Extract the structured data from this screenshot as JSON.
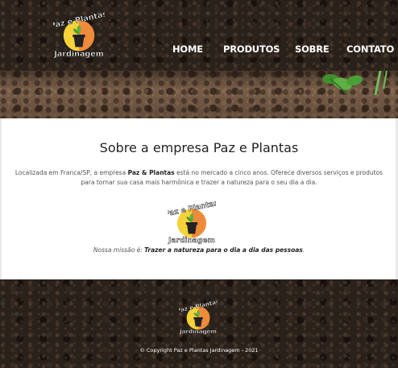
{
  "brand": {
    "logo_line1": "Paz e Plantas",
    "logo_line2": "Jardinagem"
  },
  "nav": {
    "home": "HOME",
    "produtos": "PRODUTOS",
    "sobre": "SOBRE",
    "contato": "CONTATO"
  },
  "main": {
    "title": "Sobre a empresa Paz e Plantas",
    "intro_before": "Localizada em Franca/SP, a empresa ",
    "intro_bold": "Paz & Plantas",
    "intro_after": " está no mercado a cinco anos. Oferece diversos serviços e produtos para tornar sua casa mais harmônica e trazer a natureza para o seu dia a dia.",
    "mission_label": "Nossa missão é: ",
    "mission_text": "Trazer a natureza para o dia a dia das pessoas",
    "mission_end": "."
  },
  "footer": {
    "copyright": "© Copyright Paz e Plantas Jardinagem - 2021"
  },
  "colors": {
    "logo_yellow": "#f5d23a",
    "logo_orange": "#ee8b3b",
    "pot": "#222222",
    "leaf_green": "#5cae3e"
  }
}
